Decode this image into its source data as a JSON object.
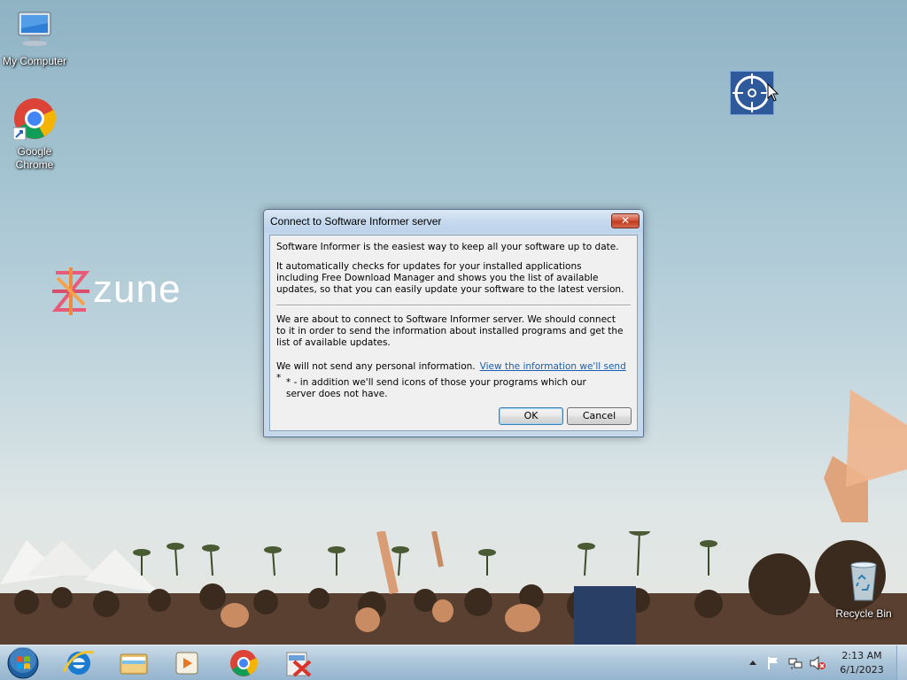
{
  "desktop": {
    "icons": [
      {
        "label": "My Computer",
        "icon": "computer-icon"
      },
      {
        "label": "Google\nChrome",
        "icon": "chrome-icon"
      },
      {
        "label": "Recycle Bin",
        "icon": "recycle-bin-icon"
      }
    ],
    "wallpaper_logo": "zune"
  },
  "dialog": {
    "title": "Connect to Software Informer server",
    "close_label": "✕",
    "para1": "Software Informer is the easiest way to keep all your software up to date.",
    "para2": "It automatically checks for updates for your installed applications including Free Download Manager and shows you the list of available updates, so that you can easily update your software to the latest version.",
    "para3": "We are about to connect to Software Informer server. We should connect to it in order to send the information about installed programs and get the list of available updates.",
    "para4": "We will not send any personal information.",
    "link": "View the information we'll send",
    "link_suffix": "*",
    "para5": "* - in addition we'll send icons of those your programs which our server does not have.",
    "ok_label": "OK",
    "cancel_label": "Cancel"
  },
  "taskbar": {
    "pinned": [
      "start-orb",
      "internet-explorer-icon",
      "file-explorer-icon",
      "media-player-icon",
      "chrome-icon",
      "app-icon"
    ],
    "clock_time": "2:13 AM",
    "clock_date": "6/1/2023"
  },
  "colors": {
    "link": "#1b5fae",
    "dialog_frame": "#c6d9ea",
    "close_button": "#c23a1e"
  }
}
